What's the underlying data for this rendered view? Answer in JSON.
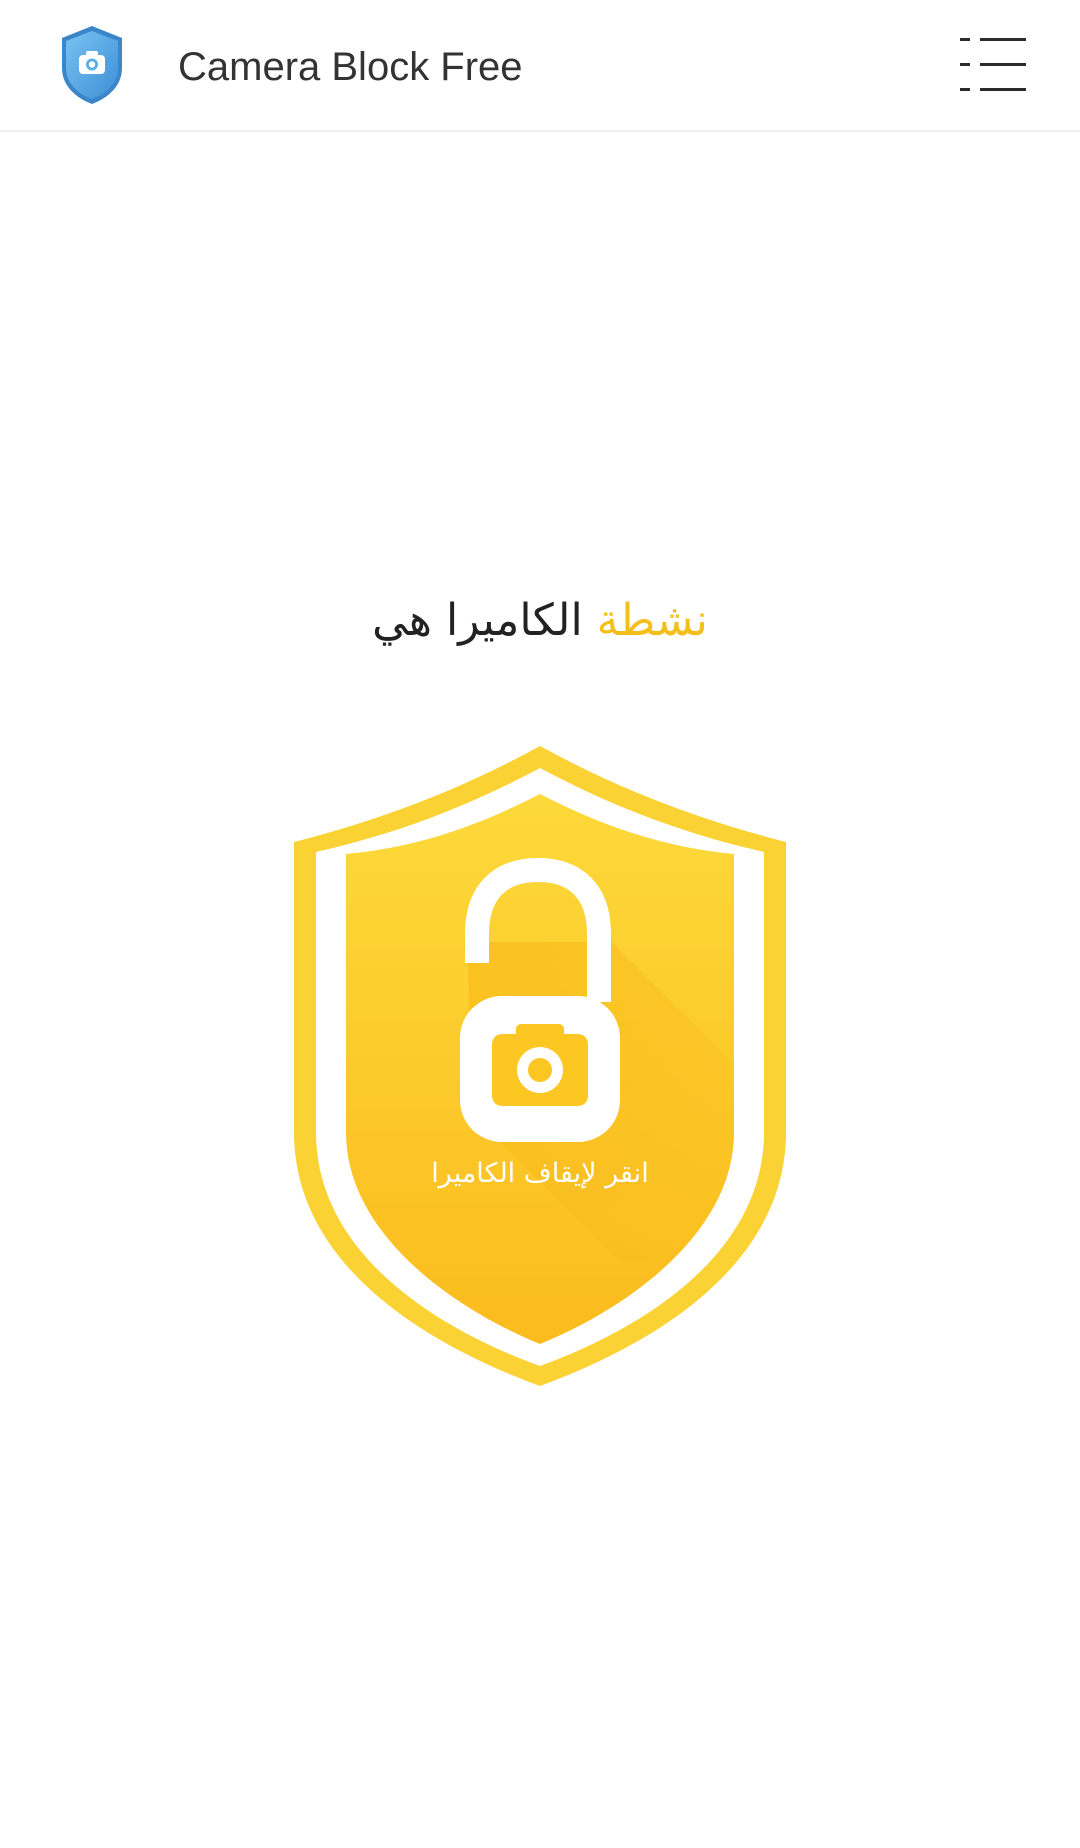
{
  "app_bar": {
    "title": "Camera Block Free",
    "logo_icon": "shield-camera-icon",
    "menu_icon": "list-menu-icon"
  },
  "status": {
    "prefix": "الكاميرا هي",
    "state": "نشطة"
  },
  "shield": {
    "icon": "unlocked-padlock-camera-icon",
    "caption": "انقر لإيقاف الكاميرا"
  },
  "colors": {
    "accent_yellow": "#f4be1b",
    "shield_outer": "#fbd234",
    "shield_inner": "#fdd22f",
    "shield_inner_dark": "#fbb61a",
    "logo_blue": "#5aaee8",
    "title_text": "#333333"
  }
}
